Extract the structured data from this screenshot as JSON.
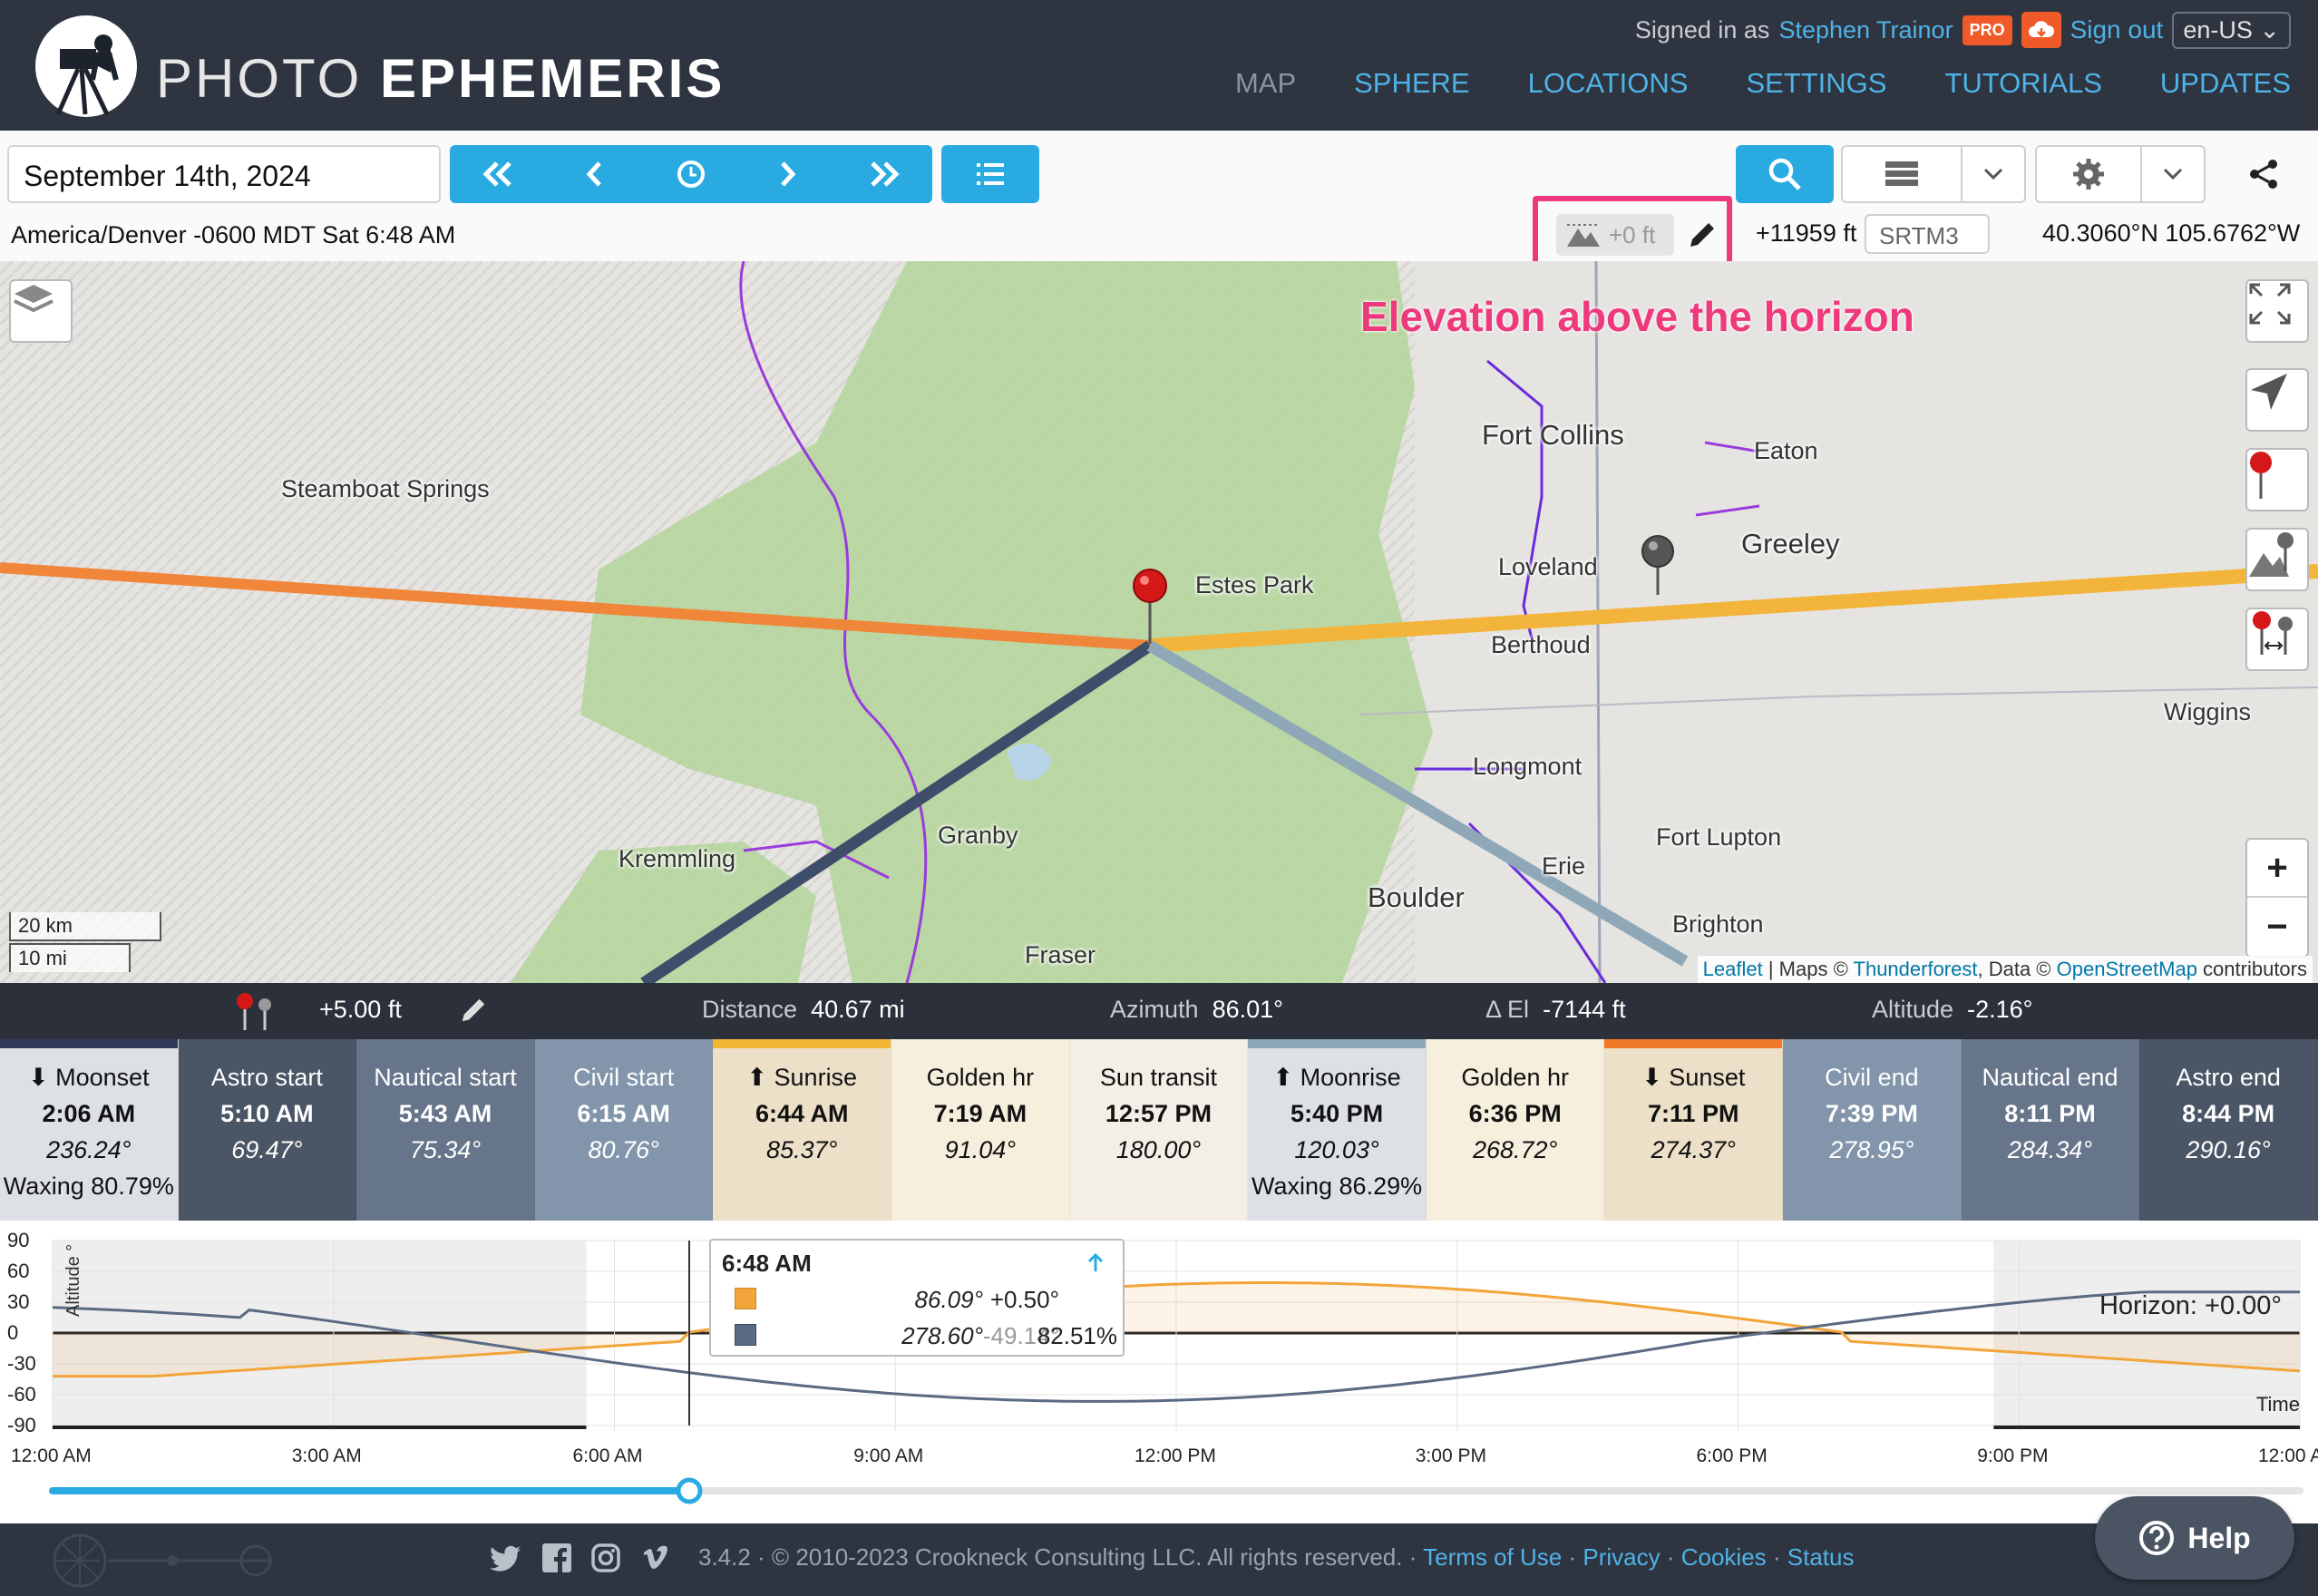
{
  "header": {
    "brand_light": "PHOTO",
    "brand_bold": "EPHEMERIS",
    "signed_in_as": "Signed in as",
    "user_name": "Stephen Trainor",
    "pro_badge": "PRO",
    "sign_out": "Sign out",
    "language": "en-US",
    "nav": [
      "MAP",
      "SPHERE",
      "LOCATIONS",
      "SETTINGS",
      "TUTORIALS",
      "UPDATES"
    ]
  },
  "toolbar": {
    "date": "September 14th, 2024",
    "timezone_line": "America/Denver -0600 MDT Sat 6:48 AM",
    "elevation_offset": "+0 ft",
    "elevation": "+11959 ft",
    "dem_source": "SRTM3",
    "coordinates": "40.3060°N 105.6762°W"
  },
  "map": {
    "annotation": "Elevation above the horizon",
    "labels": {
      "steamboat": "Steamboat Springs",
      "fort_collins": "Fort Collins",
      "eaton": "Eaton",
      "greeley": "Greeley",
      "loveland": "Loveland",
      "estes_park": "Estes Park",
      "berthoud": "Berthoud",
      "wiggins": "Wiggins",
      "longmont": "Longmont",
      "kremmling": "Kremmling",
      "granby": "Granby",
      "fort_lupton": "Fort Lupton",
      "erie": "Erie",
      "boulder": "Boulder",
      "brighton": "Brighton",
      "fraser": "Fraser"
    },
    "scale_km": "20 km",
    "scale_mi": "10 mi",
    "attribution": {
      "leaflet": "Leaflet",
      "sep": " | Maps © ",
      "thunderforest": "Thunderforest",
      "data": ", Data © ",
      "osm": "OpenStreetMap",
      "contributors": " contributors"
    },
    "zoom_in": "+",
    "zoom_out": "−"
  },
  "strip": {
    "height_offset": "+5.00 ft",
    "distance_label": "Distance",
    "distance": "40.67 mi",
    "azimuth_label": "Azimuth",
    "azimuth": "86.01°",
    "delta_el_label": "Δ El",
    "delta_el": "-7144 ft",
    "altitude_label": "Altitude",
    "altitude": "-2.16°"
  },
  "events": [
    {
      "name": "⬇ Moonset",
      "time": "2:06 AM",
      "azimuth": "236.24°",
      "extra": "Waxing 80.79%",
      "bg": "#dde0e4",
      "fg": "#111",
      "bar": "#2e3a58"
    },
    {
      "name": "Astro start",
      "time": "5:10 AM",
      "azimuth": "69.47°",
      "extra": "",
      "bg": "#4a5565",
      "fg": "#fff",
      "bar": ""
    },
    {
      "name": "Nautical start",
      "time": "5:43 AM",
      "azimuth": "75.34°",
      "extra": "",
      "bg": "#66758a",
      "fg": "#fff",
      "bar": ""
    },
    {
      "name": "Civil start",
      "time": "6:15 AM",
      "azimuth": "80.76°",
      "extra": "",
      "bg": "#8295ab",
      "fg": "#fff",
      "bar": ""
    },
    {
      "name": "⬆ Sunrise",
      "time": "6:44 AM",
      "azimuth": "85.37°",
      "extra": "",
      "bg": "#ece0c8",
      "fg": "#111",
      "bar": "#f2b632"
    },
    {
      "name": "Golden hr",
      "time": "7:19 AM",
      "azimuth": "91.04°",
      "extra": "",
      "bg": "#f7efdd",
      "fg": "#111",
      "bar": ""
    },
    {
      "name": "Sun transit",
      "time": "12:57 PM",
      "azimuth": "180.00°",
      "extra": "",
      "bg": "#f3efe6",
      "fg": "#111",
      "bar": ""
    },
    {
      "name": "⬆ Moonrise",
      "time": "5:40 PM",
      "azimuth": "120.03°",
      "extra": "Waxing 86.29%",
      "bg": "#dde0e4",
      "fg": "#111",
      "bar": "#8ea8b8"
    },
    {
      "name": "Golden hr",
      "time": "6:36 PM",
      "azimuth": "268.72°",
      "extra": "",
      "bg": "#f7efdd",
      "fg": "#111",
      "bar": ""
    },
    {
      "name": "⬇ Sunset",
      "time": "7:11 PM",
      "azimuth": "274.37°",
      "extra": "",
      "bg": "#ece0c8",
      "fg": "#111",
      "bar": "#f07a28"
    },
    {
      "name": "Civil end",
      "time": "7:39 PM",
      "azimuth": "278.95°",
      "extra": "",
      "bg": "#8295ab",
      "fg": "#fff",
      "bar": ""
    },
    {
      "name": "Nautical end",
      "time": "8:11 PM",
      "azimuth": "284.34°",
      "extra": "",
      "bg": "#66758a",
      "fg": "#fff",
      "bar": ""
    },
    {
      "name": "Astro end",
      "time": "8:44 PM",
      "azimuth": "290.16°",
      "extra": "",
      "bg": "#4a5565",
      "fg": "#fff",
      "bar": ""
    }
  ],
  "chart": {
    "y_label": "Altitude °",
    "x_label": "Time",
    "horizon_label": "Horizon: +0.00°",
    "y_ticks": [
      "90",
      "60",
      "30",
      "0",
      "-30",
      "-60",
      "-90"
    ],
    "x_ticks": [
      "12:00 AM",
      "3:00 AM",
      "6:00 AM",
      "9:00 AM",
      "12:00 PM",
      "3:00 PM",
      "6:00 PM",
      "9:00 PM",
      "12:00 AM"
    ],
    "current_time_fraction": 0.2833,
    "tooltip": {
      "time": "6:48 AM",
      "sun_azimuth": "86.09°",
      "sun_altitude": "+0.50°",
      "moon_azimuth": "278.60°",
      "moon_altitude": "-49.14°",
      "moon_illumination": "82.51%"
    },
    "colors": {
      "sun": "#f2a53a",
      "moon": "#5a6a82"
    }
  },
  "footer": {
    "text": "3.4.2 · © 2010-2023 Crookneck Consulting LLC. All rights reserved.",
    "links": [
      "Terms of Use",
      "Privacy",
      "Cookies",
      "Status"
    ],
    "help": "Help"
  }
}
